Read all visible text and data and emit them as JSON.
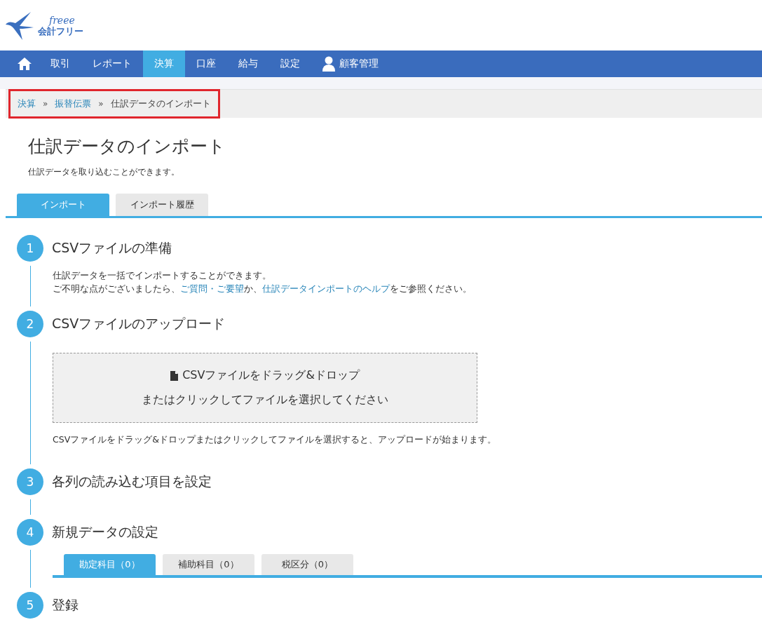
{
  "logo": {
    "script": "freee",
    "name": "会計フリー"
  },
  "nav": [
    {
      "kind": "home",
      "selected": false
    },
    {
      "kind": "text",
      "label": "取引",
      "selected": false
    },
    {
      "kind": "text",
      "label": "レポート",
      "selected": false
    },
    {
      "kind": "text",
      "label": "決算",
      "selected": true
    },
    {
      "kind": "text",
      "label": "口座",
      "selected": false
    },
    {
      "kind": "text",
      "label": "給与",
      "selected": false
    },
    {
      "kind": "text",
      "label": "設定",
      "selected": false
    },
    {
      "kind": "user",
      "label": "顧客管理",
      "selected": false
    }
  ],
  "breadcrumb": {
    "highlighted": true,
    "items": [
      {
        "label": "決算",
        "link": true
      },
      {
        "label": "振替伝票",
        "link": true
      },
      {
        "label": "仕訳データのインポート",
        "link": false
      }
    ],
    "separator": "»"
  },
  "page_title": "仕訳データのインポート",
  "description": "仕訳データを取り込むことができます。",
  "tabs": [
    {
      "label": "インポート",
      "selected": true
    },
    {
      "label": "インポート履歴",
      "selected": false
    }
  ],
  "steps": [
    {
      "number": "1",
      "title": "CSVファイルの準備",
      "kind": "text",
      "lines": [
        [
          {
            "text": "仕訳データを一括でインポートすることができます。",
            "link": false
          }
        ],
        [
          {
            "text": "ご不明な点がございましたら、",
            "link": false
          },
          {
            "text": "ご質問・ご要望",
            "link": true
          },
          {
            "text": "か、",
            "link": false
          },
          {
            "text": "仕訳データインポートのヘルプ",
            "link": true
          },
          {
            "text": "をご参照ください。",
            "link": false
          }
        ]
      ]
    },
    {
      "number": "2",
      "title": "CSVファイルのアップロード",
      "kind": "dropzone",
      "drop_title": "CSVファイルをドラッグ&ドロップ",
      "drop_subtitle": "またはクリックしてファイルを選択してください",
      "note": "CSVファイルをドラッグ&ドロップまたはクリックしてファイルを選択すると、アップロードが始まります。"
    },
    {
      "number": "3",
      "title": "各列の読み込む項目を設定",
      "kind": "empty"
    },
    {
      "number": "4",
      "title": "新規データの設定",
      "kind": "tabs",
      "tabs": [
        {
          "label": "勘定科目（0）",
          "selected": true
        },
        {
          "label": "補助科目（0）",
          "selected": false
        },
        {
          "label": "税区分（0）",
          "selected": false
        }
      ]
    },
    {
      "number": "5",
      "title": "登録",
      "kind": "empty"
    }
  ]
}
